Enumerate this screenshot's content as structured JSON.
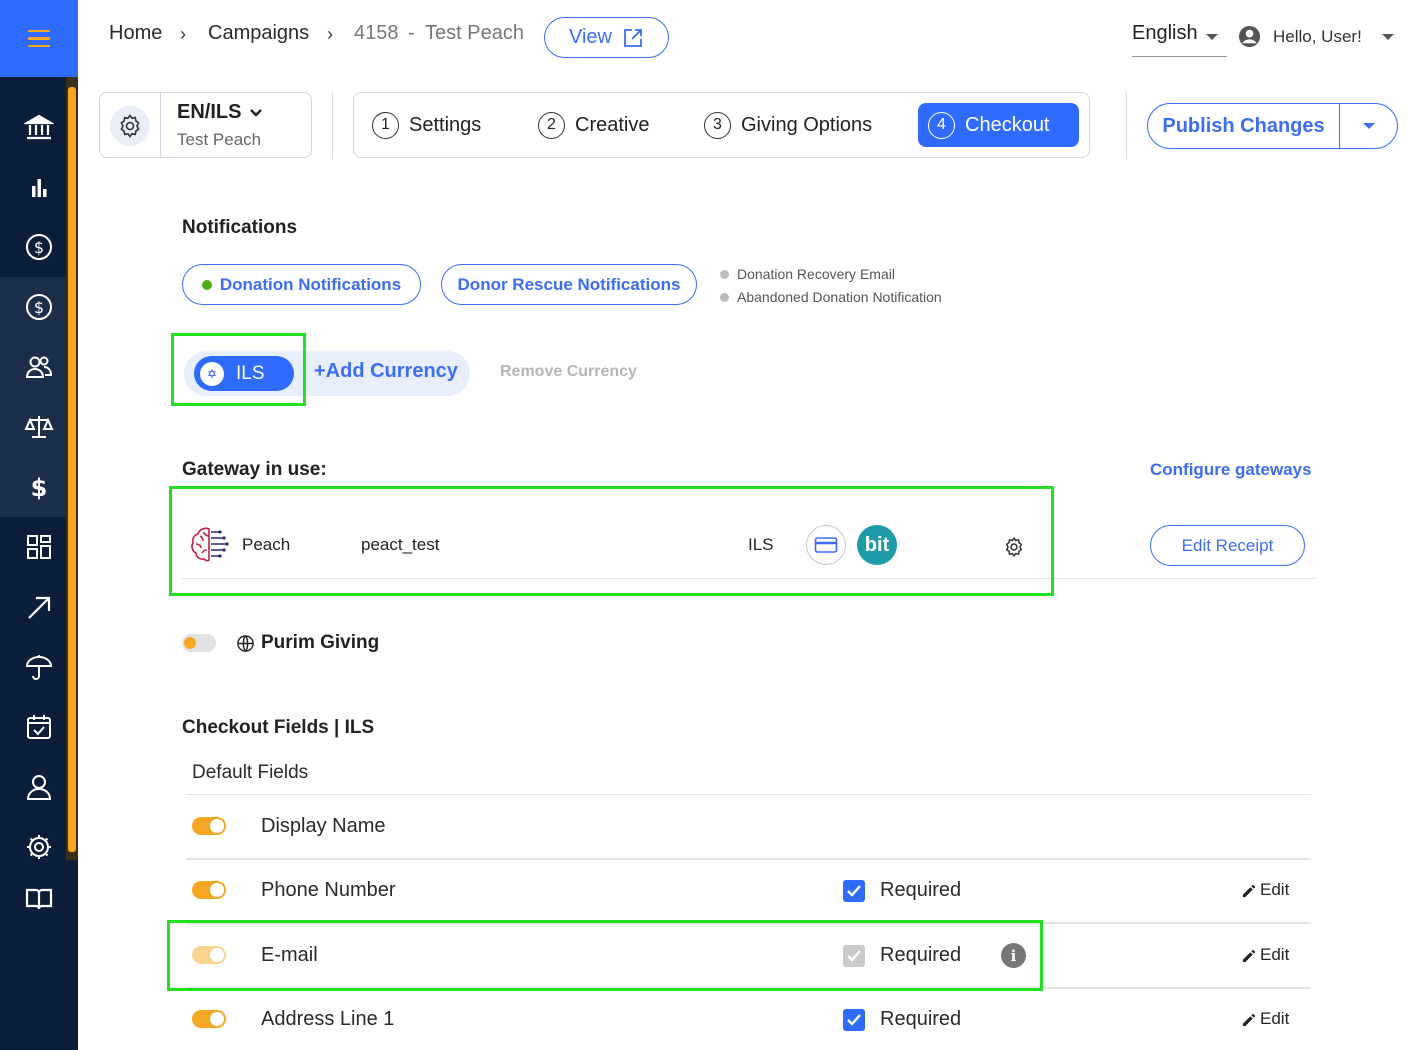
{
  "breadcrumb": {
    "home": "Home",
    "campaigns": "Campaigns",
    "campaign_id": "4158",
    "dash": "-",
    "campaign_name": "Test Peach",
    "view_label": "View"
  },
  "header": {
    "language": "English",
    "greeting": "Hello, User!"
  },
  "campaign_selector": {
    "locale": "EN/ILS",
    "name": "Test Peach"
  },
  "steps": [
    {
      "num": "1",
      "label": "Settings"
    },
    {
      "num": "2",
      "label": "Creative"
    },
    {
      "num": "3",
      "label": "Giving Options"
    },
    {
      "num": "4",
      "label": "Checkout"
    }
  ],
  "publish": {
    "label": "Publish Changes"
  },
  "notifications": {
    "title": "Notifications",
    "donation_btn": "Donation Notifications",
    "rescue_btn": "Donor Rescue Notifications",
    "legend": [
      "Donation Recovery Email",
      "Abandoned Donation Notification"
    ]
  },
  "currency": {
    "selected": "ILS",
    "add_label": "+Add Currency",
    "remove_label": "Remove Currency"
  },
  "gateway": {
    "title": "Gateway in use:",
    "configure_label": "Configure gateways",
    "provider": "Peach",
    "account": "peact_test",
    "currency": "ILS",
    "bit_label": "bit",
    "edit_receipt_label": "Edit Receipt"
  },
  "purim": {
    "label": "Purim Giving",
    "enabled": false
  },
  "checkout_fields": {
    "title": "Checkout Fields | ILS",
    "group": "Default Fields",
    "required_label": "Required",
    "edit_label": "Edit",
    "fields": [
      {
        "name": "Display Name",
        "enabled": true
      },
      {
        "name": "Phone Number",
        "enabled": true,
        "required": true
      },
      {
        "name": "E-mail",
        "enabled": true,
        "required": true,
        "locked": true
      },
      {
        "name": "Address Line 1",
        "enabled": true,
        "required": true
      }
    ]
  },
  "colors": {
    "primary": "#2f6bff",
    "sidebar": "#0c1e3a",
    "accent": "#f5a623",
    "highlight_box": "#22e022"
  }
}
